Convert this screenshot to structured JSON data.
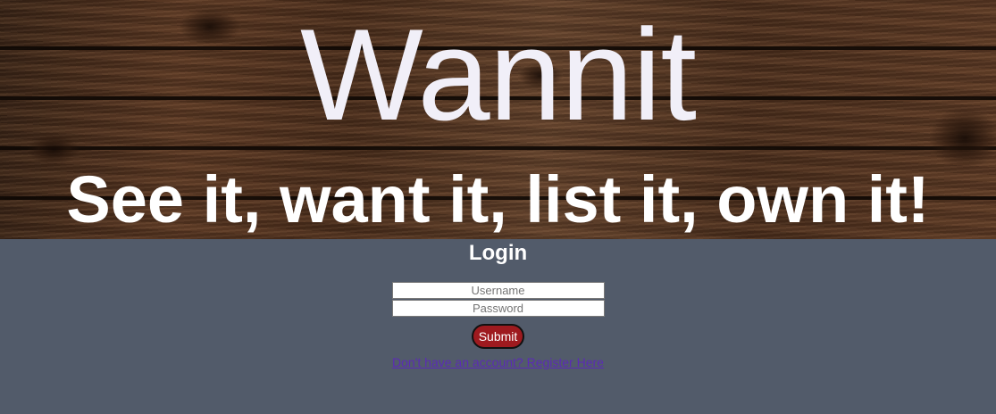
{
  "hero": {
    "brand": "Wannit",
    "tagline": "See it, want it, list it, own it!"
  },
  "login": {
    "title": "Login",
    "username_placeholder": "Username",
    "password_placeholder": "Password",
    "submit_label": "Submit",
    "register_link": "Don't have an account? Register Here"
  },
  "colors": {
    "page_background": "#525b6a",
    "submit_button": "#9e1a1f",
    "link": "#5b2bb5",
    "brand_text": "#f1eff8"
  }
}
